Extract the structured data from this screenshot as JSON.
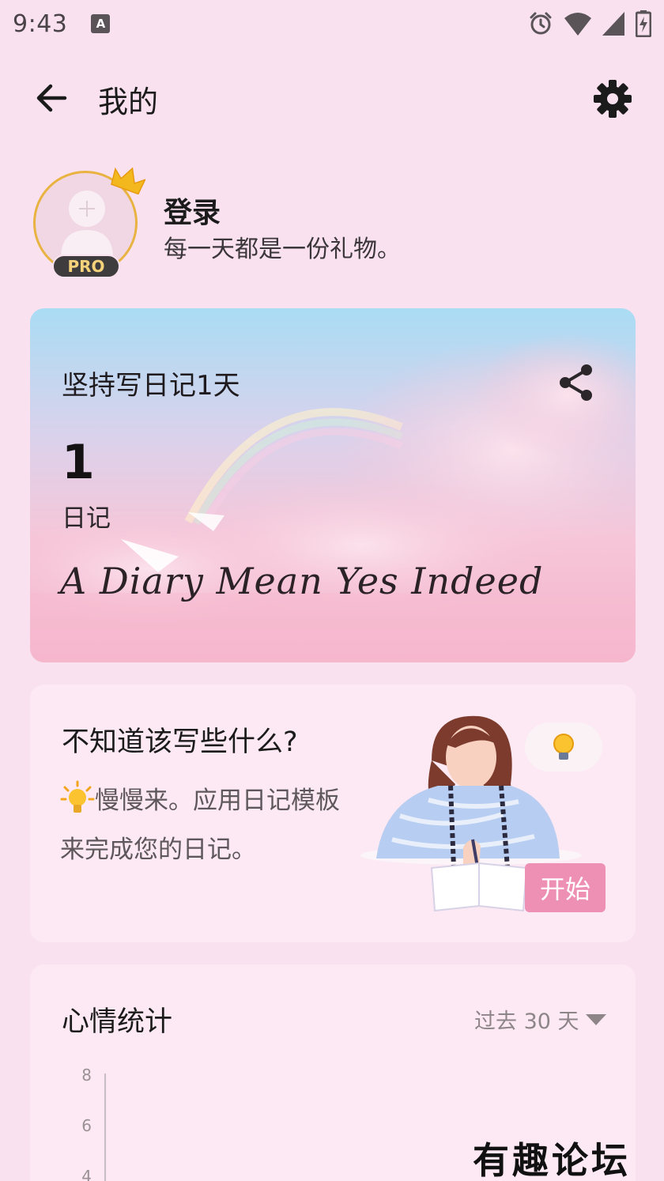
{
  "status_bar": {
    "time": "9:43",
    "notification_icon_letter": "A",
    "icons": [
      "alarm-icon",
      "wifi-icon",
      "signal-icon",
      "battery-charging-icon"
    ]
  },
  "header": {
    "title": "我的",
    "back_icon": "arrow-left-icon",
    "settings_icon": "gear-icon"
  },
  "profile": {
    "login_label": "登录",
    "tagline": "每一天都是一份礼物。",
    "badge": "PRO",
    "avatar_icon": "default-avatar-icon",
    "crown_icon": "crown-icon"
  },
  "streak_card": {
    "title": "坚持写日记1天",
    "count": "1",
    "count_label": "日记",
    "script_text": "A Diary Mean Yes Indeed",
    "share_icon": "share-icon"
  },
  "prompt_card": {
    "title": "不知道该写些什么?",
    "body": "慢慢来。应用日记模板来完成您的日记。",
    "start_button": "开始",
    "bulb_icon": "lightbulb-icon"
  },
  "mood_card": {
    "title": "心情统计",
    "period": "过去 30 天",
    "y_ticks": [
      "8",
      "6",
      "4"
    ]
  },
  "watermark": "有趣论坛",
  "colors": {
    "background": "#f9e1ef",
    "card": "#fde9f3",
    "accent": "#ee8fb4",
    "gold": "#e8b341"
  }
}
